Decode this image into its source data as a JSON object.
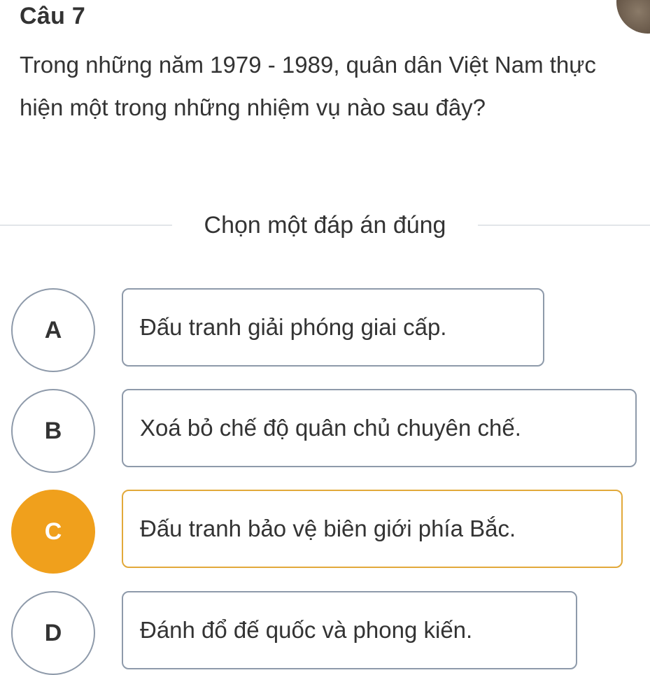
{
  "question": {
    "label": "Câu 7",
    "text": "Trong những năm 1979 - 1989, quân dân Việt Nam thực hiện một trong những nhiệm vụ nào sau đây?"
  },
  "instruction": "Chọn một đáp án đúng",
  "options": [
    {
      "letter": "A",
      "text": "Đấu tranh giải phóng giai cấp.",
      "selected": false
    },
    {
      "letter": "B",
      "text": "Xoá bỏ chế độ quân chủ chuyên chế.",
      "selected": false
    },
    {
      "letter": "C",
      "text": "Đấu tranh bảo vệ biên giới phía Bắc.",
      "selected": true
    },
    {
      "letter": "D",
      "text": "Đánh đổ đế quốc và phong kiến.",
      "selected": false
    }
  ],
  "colors": {
    "selected_accent": "#f0a01c",
    "option_border": "#8e9aaa"
  }
}
